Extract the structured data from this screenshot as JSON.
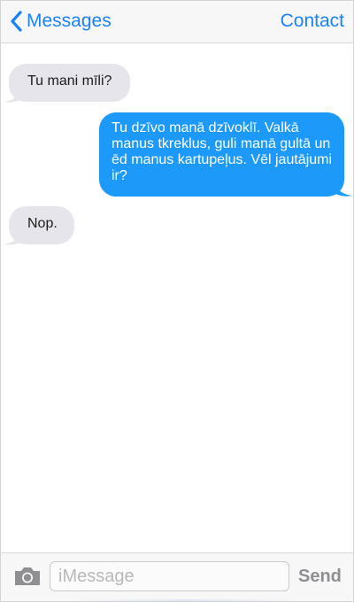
{
  "header": {
    "back_label": "Messages",
    "contact_label": "Contact"
  },
  "messages": [
    {
      "direction": "incoming",
      "text": "Tu mani mīli?"
    },
    {
      "direction": "outgoing",
      "text": "Tu dzīvo manā dzīvoklī. Valkā manus tkreklus, guli manā gultā un ēd manus kartupeļus. Vēl jautājumi ir?"
    },
    {
      "direction": "incoming",
      "text": "Nop."
    }
  ],
  "input": {
    "placeholder": "iMessage",
    "value": "",
    "send_label": "Send"
  },
  "colors": {
    "accent": "#1a82f8",
    "outgoing_bubble": "#1d9af9",
    "incoming_bubble": "#e6e5eb",
    "send_disabled": "#8e8e93"
  },
  "icons": [
    "chevron-left-icon",
    "camera-icon"
  ]
}
